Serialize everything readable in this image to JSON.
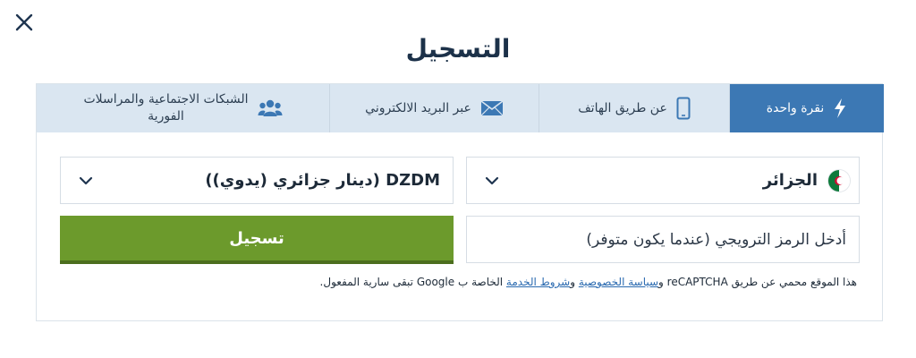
{
  "dialog": {
    "title": "التسجيل",
    "close_label": "إغلاق"
  },
  "tabs": [
    {
      "label": "نقرة واحدة",
      "icon": "lightning-icon",
      "active": true
    },
    {
      "label": "عن طريق الهاتف",
      "icon": "phone-icon",
      "active": false
    },
    {
      "label": "عبر البريد الالكتروني",
      "icon": "envelope-icon",
      "active": false
    },
    {
      "label_line1": "الشبكات الاجتماعية والمراسلات",
      "label_line2": "الفورية",
      "icon": "users-icon",
      "active": false
    }
  ],
  "form": {
    "country": {
      "value": "الجزائر",
      "flag": "algeria-flag"
    },
    "currency": {
      "value": "DZDM (دينار جزائري (يدوي))"
    },
    "promo": {
      "placeholder": "أدخل الرمز الترويجي (عندما يكون متوفر)"
    },
    "submit_label": "تسجيل"
  },
  "recaptcha": {
    "text_1": "هذا الموقع محمي عن طريق reCAPTCHA و",
    "privacy_link": "سياسة الخصوصية",
    "text_2": " و",
    "terms_link": "شروط الخدمة",
    "text_3": " الخاصة ب Google تبقى سارية المفعول."
  },
  "colors": {
    "active_tab": "#3c78b4",
    "inactive_tab": "#dae6f1",
    "submit": "#6c9a2c",
    "title": "#1c3149",
    "link": "#2a6ab0"
  }
}
